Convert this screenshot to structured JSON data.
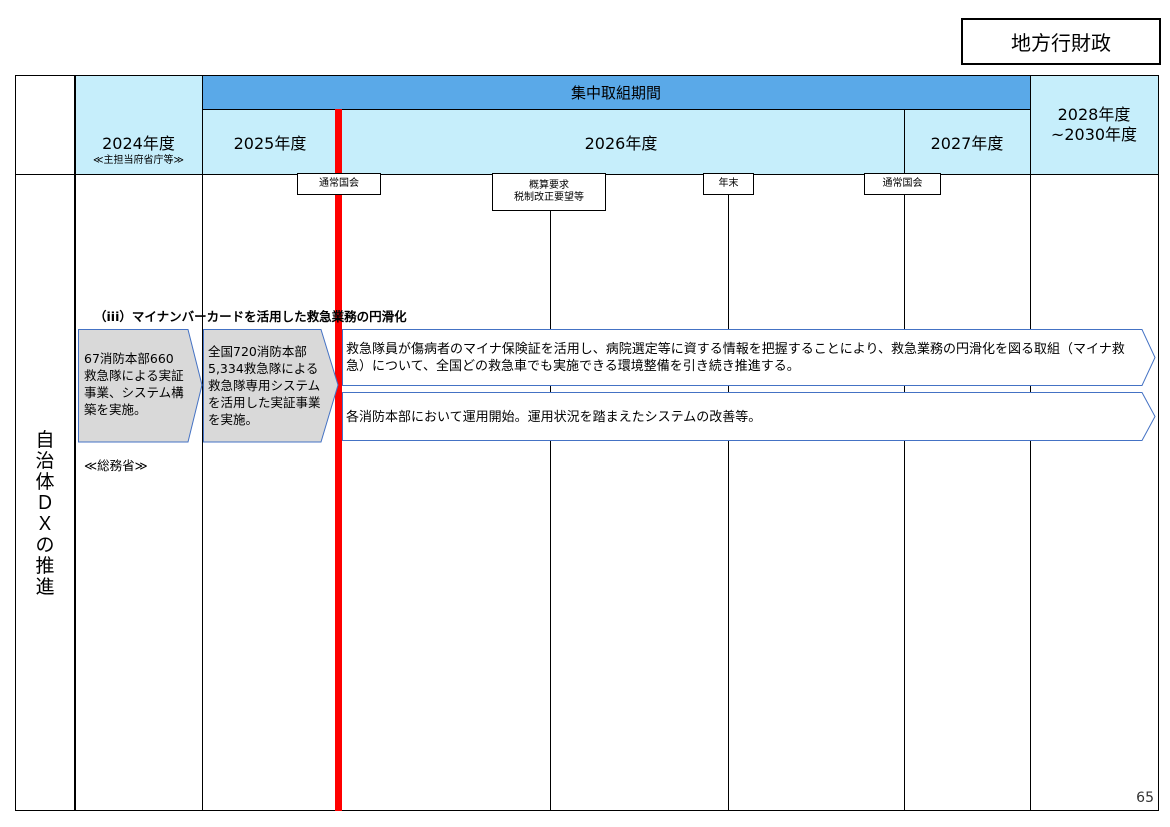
{
  "category_tag": "地方行財政",
  "header": {
    "focus_period": "集中取組期間",
    "col_2024": "2024年度",
    "col_2024_sub": "≪主担当府省庁等≫",
    "col_2025": "2025年度",
    "col_2026": "2026年度",
    "col_2027": "2027年度",
    "col_2028_line1": "2028年度",
    "col_2028_line2": "~2030年度"
  },
  "milestones": {
    "diet_1": "通常国会",
    "budget_line1": "概算要求",
    "budget_line2": "税制改正要望等",
    "year_end": "年末",
    "diet_2": "通常国会"
  },
  "side_title": [
    "自",
    "治",
    "体",
    "Ｄ",
    "Ｘ",
    "の",
    "推",
    "進"
  ],
  "section": {
    "heading": "（iii）マイナンバーカードを活用した救急業務の円滑化",
    "ministry": "≪総務省≫",
    "step_2024": "67消防本部660救急隊による実証事業、システム構築を実施。",
    "step_2025": "全国720消防本部5,334救急隊による救急隊専用システムを活用した実証事業を実施。",
    "plan_1": "救急隊員が傷病者のマイナ保険証を活用し、病院選定等に資する情報を把握することにより、救急業務の円滑化を図る取組（マイナ救急）について、全国どの救急車でも実施できる環境整備を引き続き推進する。",
    "plan_2": "各消防本部において運用開始。運用状況を踏まえたシステムの改善等。"
  },
  "page_number": "65",
  "colors": {
    "header_dark": "#5aa9e8",
    "header_light": "#c6eefb",
    "current_line": "#ff0000",
    "gray_box": "#d9d9d9",
    "arrow_border": "#4472c4"
  }
}
